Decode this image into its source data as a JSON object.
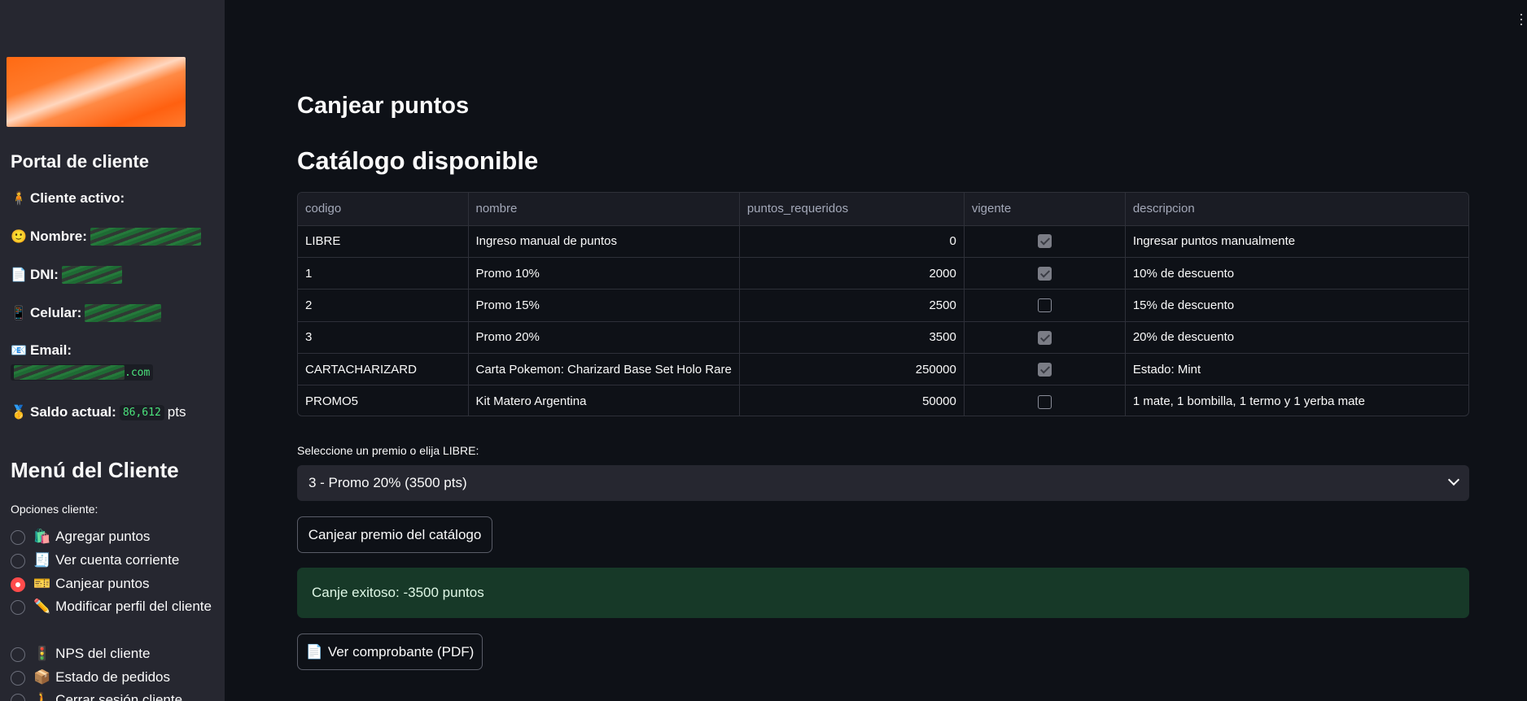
{
  "sidebar": {
    "portal_title": "Portal de cliente",
    "client_active_label": "Cliente activo:",
    "name_label": "Nombre:",
    "dni_label": "DNI:",
    "phone_label": "Celular:",
    "email_label": "Email:",
    "email_suffix": ".com",
    "balance_label": "Saldo actual:",
    "balance_value": "86,612",
    "balance_unit": "pts",
    "menu_title": "Menú del Cliente",
    "options_label": "Opciones cliente:",
    "options": [
      {
        "icon": "🛍️",
        "label": "Agregar puntos",
        "selected": false
      },
      {
        "icon": "🧾",
        "label": "Ver cuenta corriente",
        "selected": false
      },
      {
        "icon": "🎫",
        "label": "Canjear puntos",
        "selected": true
      },
      {
        "icon": "✏️",
        "label": "Modificar perfil del cliente",
        "selected": false
      },
      {
        "icon": "🚦",
        "label": "NPS del cliente",
        "selected": false
      },
      {
        "icon": "📦",
        "label": "Estado de pedidos",
        "selected": false
      },
      {
        "icon": "🚶",
        "label": "Cerrar sesión cliente",
        "selected": false
      }
    ],
    "icons": {
      "client": "🧍",
      "name": "🙂",
      "dni": "📄",
      "phone": "📱",
      "email": "📧",
      "balance": "🥇"
    }
  },
  "main": {
    "title": "Canjear puntos",
    "catalog_title": "Catálogo disponible",
    "table": {
      "columns": [
        "codigo",
        "nombre",
        "puntos_requeridos",
        "vigente",
        "descripcion"
      ],
      "rows": [
        {
          "codigo": "LIBRE",
          "nombre": "Ingreso manual de puntos",
          "puntos": "0",
          "vigente": true,
          "descripcion": "Ingresar puntos manualmente"
        },
        {
          "codigo": "1",
          "nombre": "Promo 10%",
          "puntos": "2000",
          "vigente": true,
          "descripcion": "10% de descuento"
        },
        {
          "codigo": "2",
          "nombre": "Promo 15%",
          "puntos": "2500",
          "vigente": false,
          "descripcion": "15% de descuento"
        },
        {
          "codigo": "3",
          "nombre": "Promo 20%",
          "puntos": "3500",
          "vigente": true,
          "descripcion": "20% de descuento"
        },
        {
          "codigo": "CARTACHARIZARD",
          "nombre": "Carta Pokemon: Charizard Base Set Holo Rare",
          "puntos": "250000",
          "vigente": true,
          "descripcion": "Estado: Mint"
        },
        {
          "codigo": "PROMO5",
          "nombre": "Kit Matero Argentina",
          "puntos": "50000",
          "vigente": false,
          "descripcion": "1 mate, 1 bombilla, 1 termo y 1 yerba mate"
        }
      ]
    },
    "select_label": "Seleccione un premio o elija LIBRE:",
    "select_value": "3 - Promo 20% (3500 pts)",
    "redeem_button": "Canjear premio del catálogo",
    "success_message": "Canje exitoso: -3500 puntos",
    "pdf_icon": "📄",
    "pdf_button": "Ver comprobante (PDF)"
  }
}
